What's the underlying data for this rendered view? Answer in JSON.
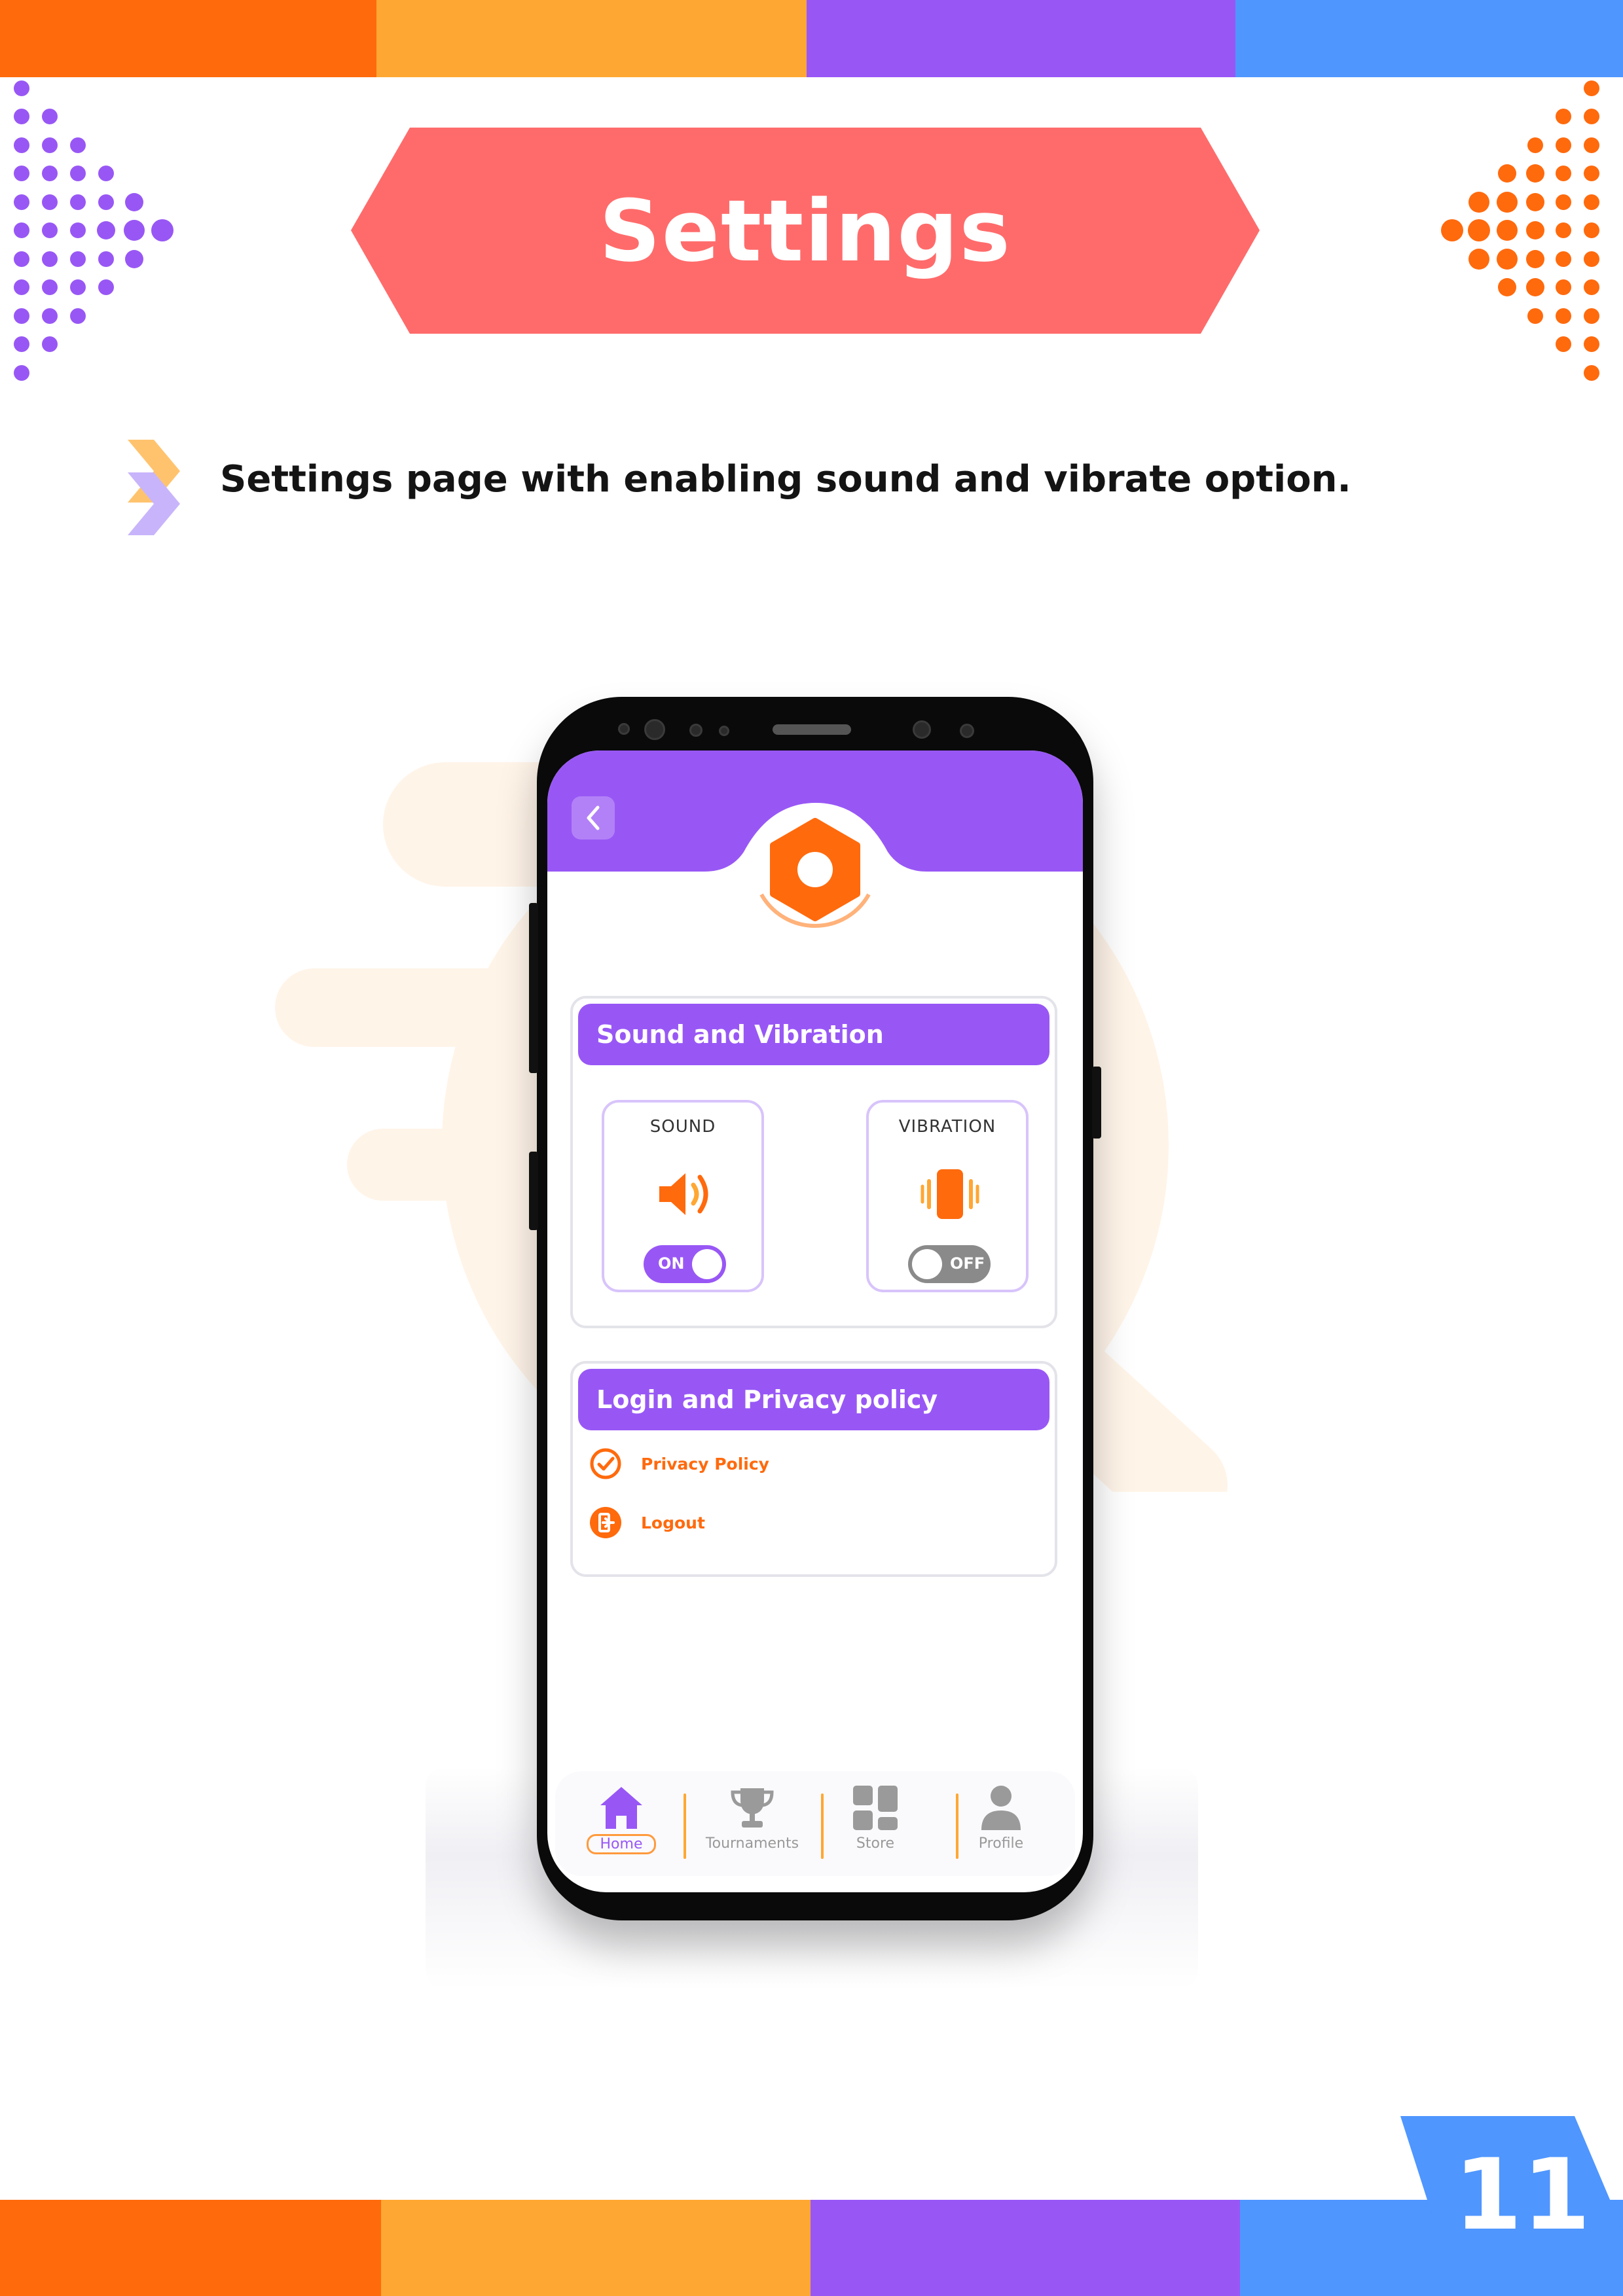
{
  "page": {
    "title": "Settings",
    "bullet_text": "Settings page with enabling sound and vibrate option.",
    "page_number": "11"
  },
  "colors": {
    "orange": "#FF6A0D",
    "amber": "#FFA733",
    "purple": "#9857F5",
    "blue": "#4F96FF",
    "banner": "#FF6B6B"
  },
  "app": {
    "back_icon": "chevron-left-icon",
    "header_icon": "gear-icon",
    "sound_section": {
      "title": "Sound and Vibration",
      "sound": {
        "label": "SOUND",
        "icon": "speaker-icon",
        "toggle_text": "ON",
        "enabled": true
      },
      "vibration": {
        "label": "VIBRATION",
        "icon": "vibrate-icon",
        "toggle_text": "OFF",
        "enabled": false
      }
    },
    "privacy_section": {
      "title": "Login and Privacy policy",
      "items": [
        {
          "label": "Privacy Policy",
          "icon": "check-circle-icon"
        },
        {
          "label": "Logout",
          "icon": "logout-icon"
        }
      ]
    },
    "bottom_nav": [
      {
        "label": "Home",
        "icon": "home-icon",
        "active": true
      },
      {
        "label": "Tournaments",
        "icon": "trophy-icon",
        "active": false
      },
      {
        "label": "Store",
        "icon": "store-grid-icon",
        "active": false
      },
      {
        "label": "Profile",
        "icon": "profile-icon",
        "active": false
      }
    ]
  }
}
